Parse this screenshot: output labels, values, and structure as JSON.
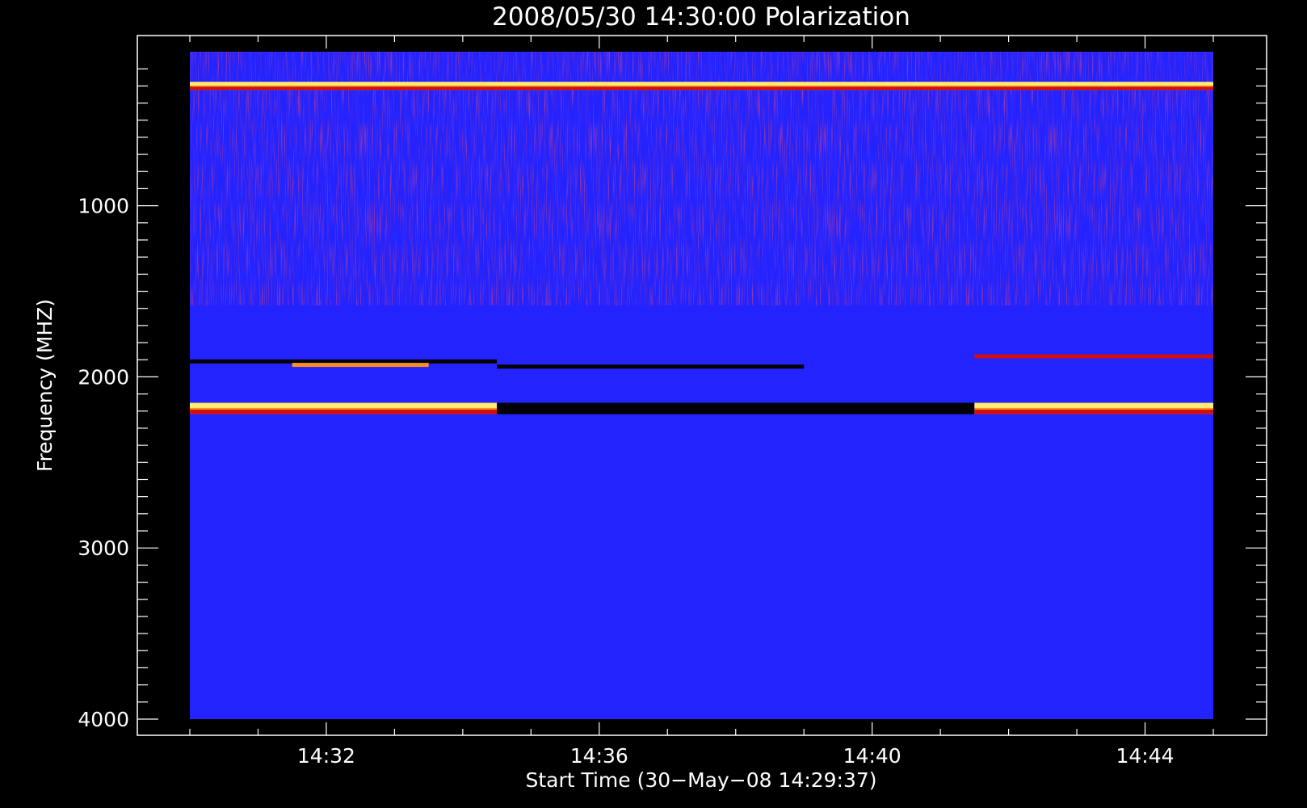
{
  "chart_data": {
    "type": "heatmap",
    "title": "2008/05/30 14:30:00 Polarization",
    "xlabel": "Start Time (30−May−08 14:29:37)",
    "ylabel": "Frequency (MHZ)",
    "x_tick_labels": [
      "14:32",
      "14:36",
      "14:40",
      "14:44"
    ],
    "x_tick_minutes": [
      2,
      6,
      10,
      14
    ],
    "x_range_minutes": [
      0.0,
      15.0
    ],
    "y_ticks": [
      1000,
      2000,
      3000,
      4000
    ],
    "y_tick_labels": [
      "1000",
      "2000",
      "3000",
      "4000"
    ],
    "y_range": [
      100,
      4000
    ],
    "y_inverted": true,
    "background_color": "#2323ff",
    "colormap": [
      "#000000",
      "#2323ff",
      "#d01010",
      "#ff9020",
      "#ffff80"
    ],
    "features": [
      {
        "name": "bright band",
        "freq_mhz": 2185,
        "level": "high",
        "x_minutes": [
          0.0,
          4.5
        ]
      },
      {
        "name": "dark band",
        "freq_mhz": 2185,
        "level": "low",
        "x_minutes": [
          4.5,
          11.5
        ]
      },
      {
        "name": "bright band",
        "freq_mhz": 2185,
        "level": "high",
        "x_minutes": [
          11.5,
          15.0
        ]
      },
      {
        "name": "dark line",
        "freq_mhz": 1910,
        "level": "low",
        "x_minutes": [
          0.0,
          4.5
        ]
      },
      {
        "name": "dark line",
        "freq_mhz": 1940,
        "level": "low",
        "x_minutes": [
          4.5,
          9.0
        ]
      },
      {
        "name": "bright segments",
        "freq_mhz": 1930,
        "level": "high",
        "x_minutes": [
          1.5,
          3.5
        ]
      },
      {
        "name": "red line",
        "freq_mhz": 1880,
        "level": "mid",
        "x_minutes": [
          11.5,
          15.0
        ]
      },
      {
        "name": "interference",
        "freq_mhz": 300,
        "level": "high",
        "x_minutes": [
          0.0,
          15.0
        ]
      }
    ]
  }
}
